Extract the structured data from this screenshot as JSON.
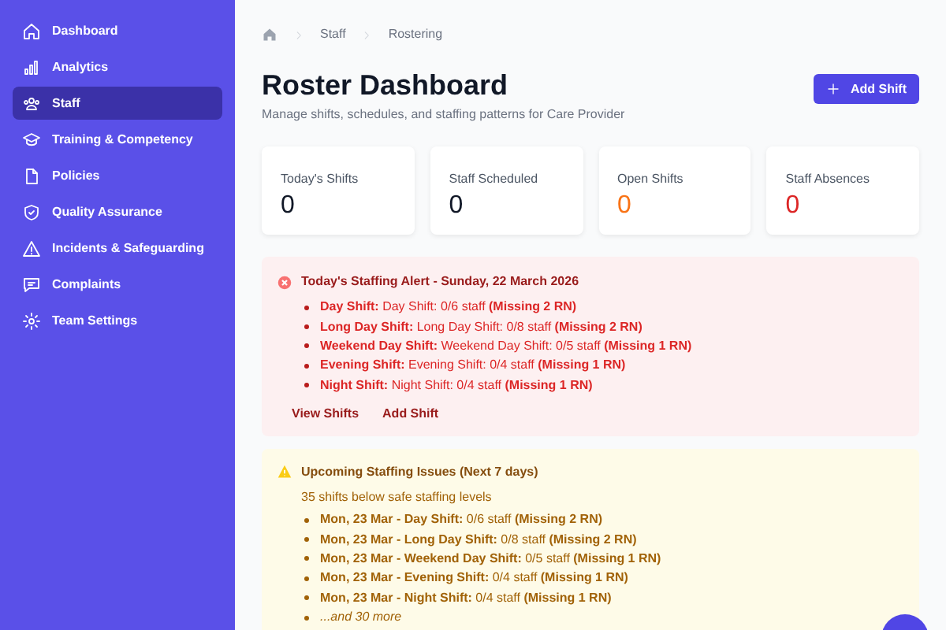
{
  "sidebar": {
    "items": [
      {
        "label": "Dashboard",
        "selected": false
      },
      {
        "label": "Analytics",
        "selected": false
      },
      {
        "label": "Staff",
        "selected": true
      },
      {
        "label": "Training & Competency",
        "selected": false
      },
      {
        "label": "Policies",
        "selected": false
      },
      {
        "label": "Quality Assurance",
        "selected": false
      },
      {
        "label": "Incidents & Safeguarding",
        "selected": false
      },
      {
        "label": "Complaints",
        "selected": false
      },
      {
        "label": "Team Settings",
        "selected": false
      }
    ]
  },
  "breadcrumb": [
    "Staff",
    "Rostering"
  ],
  "header": {
    "title": "Roster Dashboard",
    "subtitle": "Manage shifts, schedules, and staffing patterns for Care Provider",
    "button": "Add Shift"
  },
  "stats": [
    {
      "label": "Today's Shifts",
      "value": "0",
      "color": "#111827"
    },
    {
      "label": "Staff Scheduled",
      "value": "0",
      "color": "#111827"
    },
    {
      "label": "Open Shifts",
      "value": "0",
      "color": "#f97316"
    },
    {
      "label": "Staff Absences",
      "value": "0",
      "color": "#dc2626"
    }
  ],
  "alerts": [
    {
      "kind": "error",
      "title": "Today's Staffing Alert - Sunday, 22 March 2026",
      "items": [
        "**Day Shift:** Day Shift: 0/6 staff **(Missing 2 RN)**",
        "**Long Day Shift:** Long Day Shift: 0/8 staff **(Missing 2 RN)**",
        "**Weekend Day Shift:** Weekend Day Shift: 0/5 staff **(Missing 1 RN)**",
        "**Evening Shift:** Evening Shift: 0/4 staff **(Missing 1 RN)**",
        "**Night Shift:** Night Shift: 0/4 staff **(Missing 1 RN)**"
      ],
      "links": [
        "View Shifts",
        "Add Shift"
      ]
    },
    {
      "kind": "warning",
      "title": "Upcoming Staffing Issues (Next 7 days)",
      "summary": "35 shifts below safe staffing levels",
      "items": [
        "**Mon, 23 Mar - Day Shift:** 0/6 staff **(Missing 2 RN)**",
        "**Mon, 23 Mar - Long Day Shift:** 0/8 staff **(Missing 2 RN)**",
        "**Mon, 23 Mar - Weekend Day Shift:** 0/5 staff **(Missing 1 RN)**",
        "**Mon, 23 Mar - Evening Shift:** 0/4 staff **(Missing 1 RN)**",
        "**Mon, 23 Mar - Night Shift:** 0/4 staff **(Missing 1 RN)**"
      ],
      "more": "...and 30 more"
    }
  ]
}
